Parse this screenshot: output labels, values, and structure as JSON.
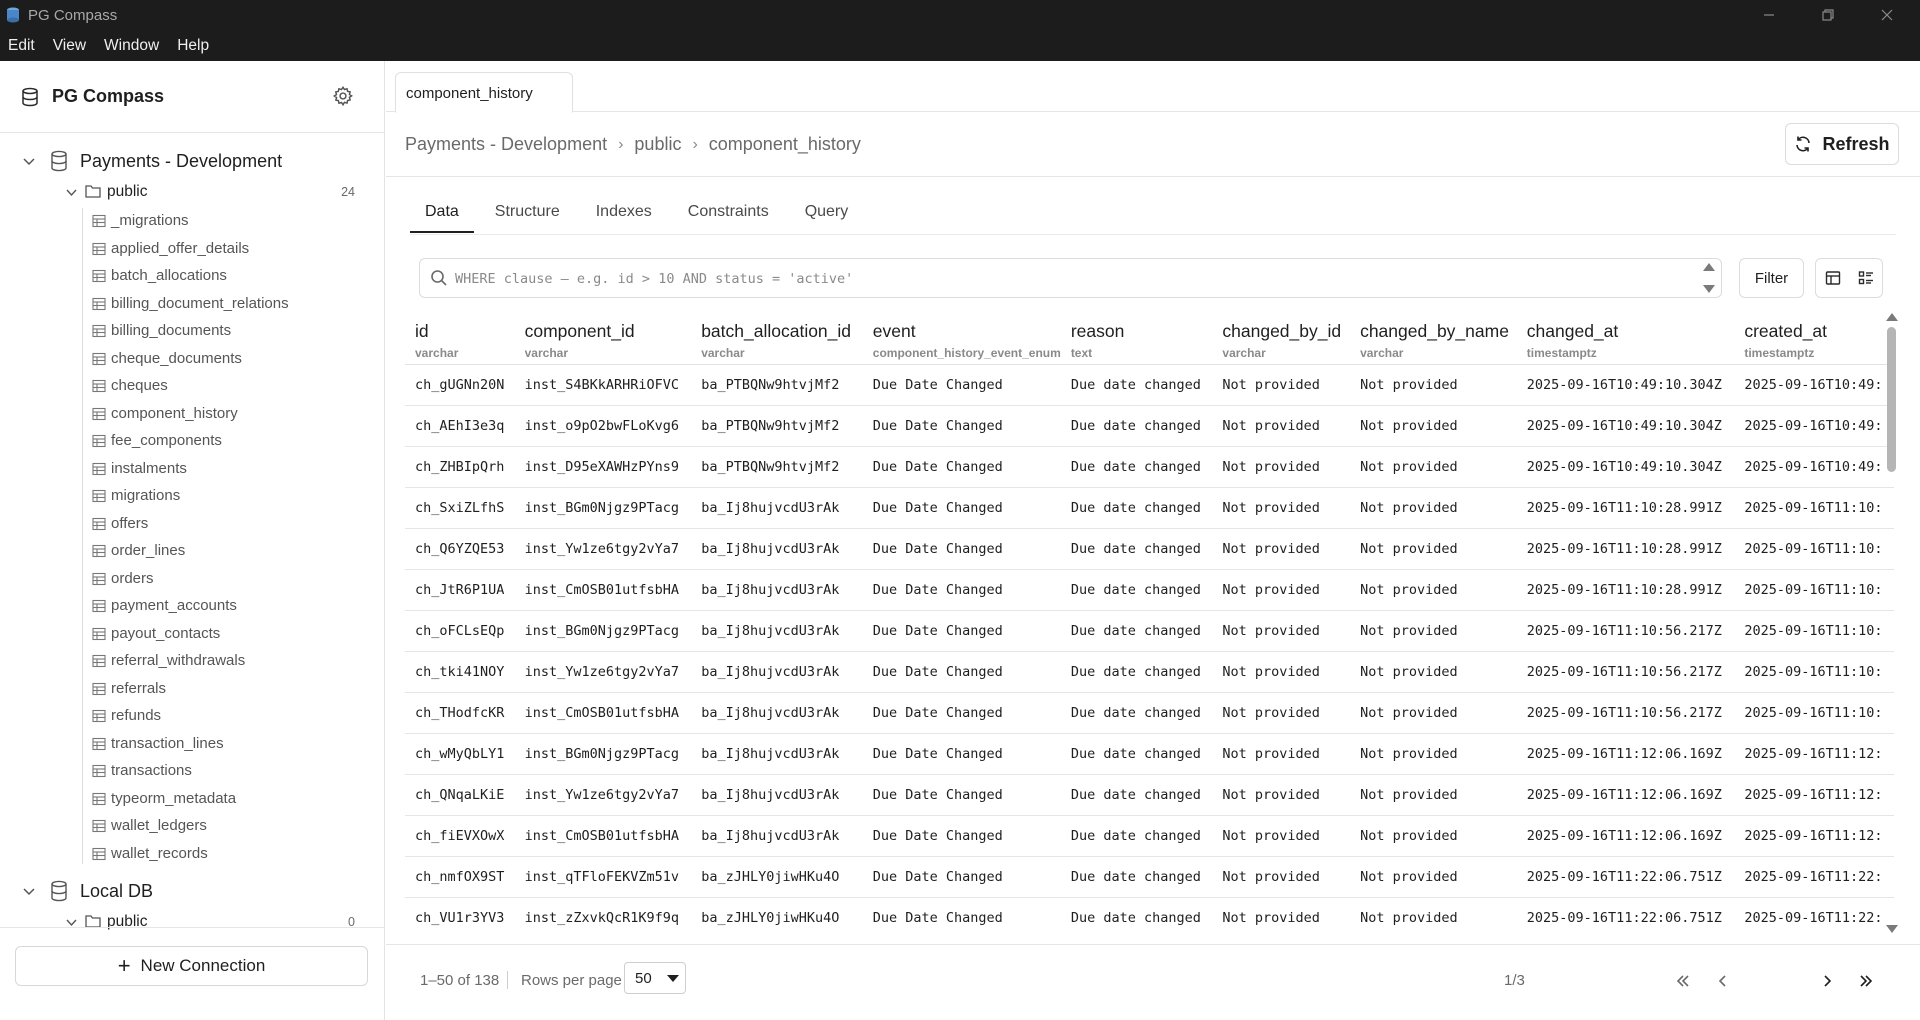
{
  "window": {
    "title": "PG Compass"
  },
  "menu": [
    "Edit",
    "View",
    "Window",
    "Help"
  ],
  "sidebar": {
    "brand": "PG Compass",
    "connections": [
      {
        "name": "Payments - Development",
        "schema": "public",
        "count": "24",
        "tables": [
          "_migrations",
          "applied_offer_details",
          "batch_allocations",
          "billing_document_relations",
          "billing_documents",
          "cheque_documents",
          "cheques",
          "component_history",
          "fee_components",
          "instalments",
          "migrations",
          "offers",
          "order_lines",
          "orders",
          "payment_accounts",
          "payout_contacts",
          "referral_withdrawals",
          "referrals",
          "refunds",
          "transaction_lines",
          "transactions",
          "typeorm_metadata",
          "wallet_ledgers",
          "wallet_records"
        ]
      },
      {
        "name": "Local DB",
        "schema": "public",
        "count": "0"
      }
    ],
    "new_connection": "New Connection"
  },
  "tab": {
    "label": "component_history"
  },
  "breadcrumb": [
    "Payments - Development",
    "public",
    "component_history"
  ],
  "refresh_label": "Refresh",
  "section_tabs": [
    "Data",
    "Structure",
    "Indexes",
    "Constraints",
    "Query"
  ],
  "where": {
    "placeholder": "WHERE clause — e.g. id > 10 AND status = 'active'"
  },
  "filter_label": "Filter",
  "grid": {
    "columns": [
      {
        "name": "id",
        "type": "varchar"
      },
      {
        "name": "component_id",
        "type": "varchar"
      },
      {
        "name": "batch_allocation_id",
        "type": "varchar"
      },
      {
        "name": "event",
        "type": "component_history_event_enum"
      },
      {
        "name": "reason",
        "type": "text"
      },
      {
        "name": "changed_by_id",
        "type": "varchar"
      },
      {
        "name": "changed_by_name",
        "type": "varchar"
      },
      {
        "name": "changed_at",
        "type": "timestamptz"
      },
      {
        "name": "created_at",
        "type": "timestamptz"
      }
    ],
    "rows": [
      [
        "ch_gUGNn20N",
        "inst_S4BKkARHRiOFVC",
        "ba_PTBQNw9htvjMf2",
        "Due Date Changed",
        "Due date changed",
        "Not provided",
        "Not provided",
        "2025-09-16T10:49:10.304Z",
        "2025-09-16T10:49:"
      ],
      [
        "ch_AEhI3e3q",
        "inst_o9pO2bwFLoKvg6",
        "ba_PTBQNw9htvjMf2",
        "Due Date Changed",
        "Due date changed",
        "Not provided",
        "Not provided",
        "2025-09-16T10:49:10.304Z",
        "2025-09-16T10:49:"
      ],
      [
        "ch_ZHBIpQrh",
        "inst_D95eXAWHzPYns9",
        "ba_PTBQNw9htvjMf2",
        "Due Date Changed",
        "Due date changed",
        "Not provided",
        "Not provided",
        "2025-09-16T10:49:10.304Z",
        "2025-09-16T10:49:"
      ],
      [
        "ch_SxiZLfhS",
        "inst_BGm0Njgz9PTacg",
        "ba_Ij8hujvcdU3rAk",
        "Due Date Changed",
        "Due date changed",
        "Not provided",
        "Not provided",
        "2025-09-16T11:10:28.991Z",
        "2025-09-16T11:10:"
      ],
      [
        "ch_Q6YZQE53",
        "inst_Yw1ze6tgy2vYa7",
        "ba_Ij8hujvcdU3rAk",
        "Due Date Changed",
        "Due date changed",
        "Not provided",
        "Not provided",
        "2025-09-16T11:10:28.991Z",
        "2025-09-16T11:10:"
      ],
      [
        "ch_JtR6P1UA",
        "inst_CmOSB01utfsbHA",
        "ba_Ij8hujvcdU3rAk",
        "Due Date Changed",
        "Due date changed",
        "Not provided",
        "Not provided",
        "2025-09-16T11:10:28.991Z",
        "2025-09-16T11:10:"
      ],
      [
        "ch_oFCLsEQp",
        "inst_BGm0Njgz9PTacg",
        "ba_Ij8hujvcdU3rAk",
        "Due Date Changed",
        "Due date changed",
        "Not provided",
        "Not provided",
        "2025-09-16T11:10:56.217Z",
        "2025-09-16T11:10:"
      ],
      [
        "ch_tki41NOY",
        "inst_Yw1ze6tgy2vYa7",
        "ba_Ij8hujvcdU3rAk",
        "Due Date Changed",
        "Due date changed",
        "Not provided",
        "Not provided",
        "2025-09-16T11:10:56.217Z",
        "2025-09-16T11:10:"
      ],
      [
        "ch_THodfcKR",
        "inst_CmOSB01utfsbHA",
        "ba_Ij8hujvcdU3rAk",
        "Due Date Changed",
        "Due date changed",
        "Not provided",
        "Not provided",
        "2025-09-16T11:10:56.217Z",
        "2025-09-16T11:10:"
      ],
      [
        "ch_wMyQbLY1",
        "inst_BGm0Njgz9PTacg",
        "ba_Ij8hujvcdU3rAk",
        "Due Date Changed",
        "Due date changed",
        "Not provided",
        "Not provided",
        "2025-09-16T11:12:06.169Z",
        "2025-09-16T11:12:"
      ],
      [
        "ch_QNqaLKiE",
        "inst_Yw1ze6tgy2vYa7",
        "ba_Ij8hujvcdU3rAk",
        "Due Date Changed",
        "Due date changed",
        "Not provided",
        "Not provided",
        "2025-09-16T11:12:06.169Z",
        "2025-09-16T11:12:"
      ],
      [
        "ch_fiEVXOwX",
        "inst_CmOSB01utfsbHA",
        "ba_Ij8hujvcdU3rAk",
        "Due Date Changed",
        "Due date changed",
        "Not provided",
        "Not provided",
        "2025-09-16T11:12:06.169Z",
        "2025-09-16T11:12:"
      ],
      [
        "ch_nmfOX9ST",
        "inst_qTFloFEKVZm51v",
        "ba_zJHLY0jiwHKu4O",
        "Due Date Changed",
        "Due date changed",
        "Not provided",
        "Not provided",
        "2025-09-16T11:22:06.751Z",
        "2025-09-16T11:22:"
      ],
      [
        "ch_VU1r3YV3",
        "inst_zZxvkQcR1K9f9q",
        "ba_zJHLY0jiwHKu4O",
        "Due Date Changed",
        "Due date changed",
        "Not provided",
        "Not provided",
        "2025-09-16T11:22:06.751Z",
        "2025-09-16T11:22:"
      ]
    ]
  },
  "pager": {
    "range": "1–50 of 138",
    "rows_per_page_label": "Rows per page",
    "rows_per_page": "50",
    "page_indicator": "1/3"
  },
  "icons": {
    "app": "app-cylinder-icon",
    "settings": "gear-icon",
    "database": "database-icon",
    "folder": "folder-icon",
    "table": "table-icon",
    "refresh": "refresh-icon",
    "search": "search-icon",
    "grid_view": "grid-view-icon",
    "detail_view": "detail-view-icon",
    "first": "first-page-icon",
    "prev": "prev-page-icon",
    "next": "next-page-icon",
    "last": "last-page-icon"
  }
}
